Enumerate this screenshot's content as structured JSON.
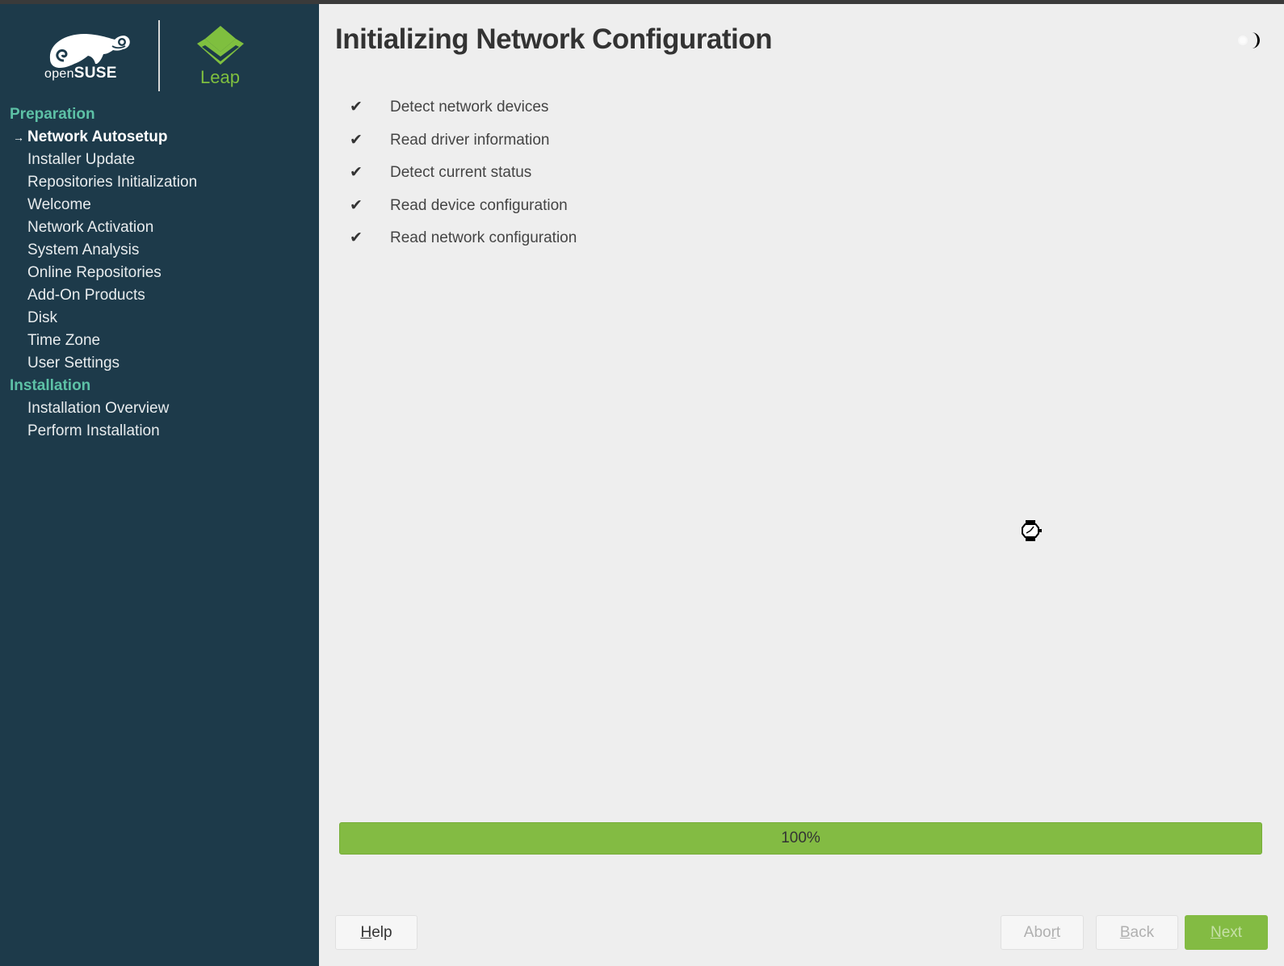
{
  "window": {
    "title": "Initializing Network Configuration"
  },
  "branding": {
    "distro_open": "open",
    "distro_suse": "SUSE",
    "product": "Leap",
    "accent_color": "#83bb43",
    "sidebar_bg": "#1d3a4a",
    "section_color": "#5dc1a6"
  },
  "sidebar": {
    "sections": [
      {
        "label": "Preparation",
        "items": [
          {
            "label": "Network Autosetup",
            "current": true
          },
          {
            "label": "Installer Update"
          },
          {
            "label": "Repositories Initialization"
          },
          {
            "label": "Welcome"
          },
          {
            "label": "Network Activation"
          },
          {
            "label": "System Analysis"
          },
          {
            "label": "Online Repositories"
          },
          {
            "label": "Add-On Products"
          },
          {
            "label": "Disk"
          },
          {
            "label": "Time Zone"
          },
          {
            "label": "User Settings"
          }
        ]
      },
      {
        "label": "Installation",
        "items": [
          {
            "label": "Installation Overview"
          },
          {
            "label": "Perform Installation"
          }
        ]
      }
    ],
    "current_marker": "→"
  },
  "main": {
    "title": "Initializing Network Configuration",
    "theme_toggle_icon": "moon-icon",
    "steps": [
      {
        "label": "Detect network devices",
        "done": true,
        "mark": "✔"
      },
      {
        "label": "Read driver information",
        "done": true,
        "mark": "✔"
      },
      {
        "label": "Detect current status",
        "done": true,
        "mark": "✔"
      },
      {
        "label": "Read device configuration",
        "done": true,
        "mark": "✔"
      },
      {
        "label": "Read network configuration",
        "done": true,
        "mark": "✔"
      }
    ],
    "progress": {
      "percent": 100,
      "label": "100%"
    },
    "cursor": "busy-watch-cursor"
  },
  "buttons": {
    "help": {
      "mnemonic": "H",
      "rest": "elp",
      "enabled": true
    },
    "abort": {
      "pre": "Abo",
      "mnemonic": "r",
      "rest": "t",
      "enabled": false
    },
    "back": {
      "mnemonic": "B",
      "rest": "ack",
      "enabled": false
    },
    "next": {
      "mnemonic": "N",
      "rest": "ext",
      "enabled": false
    }
  }
}
